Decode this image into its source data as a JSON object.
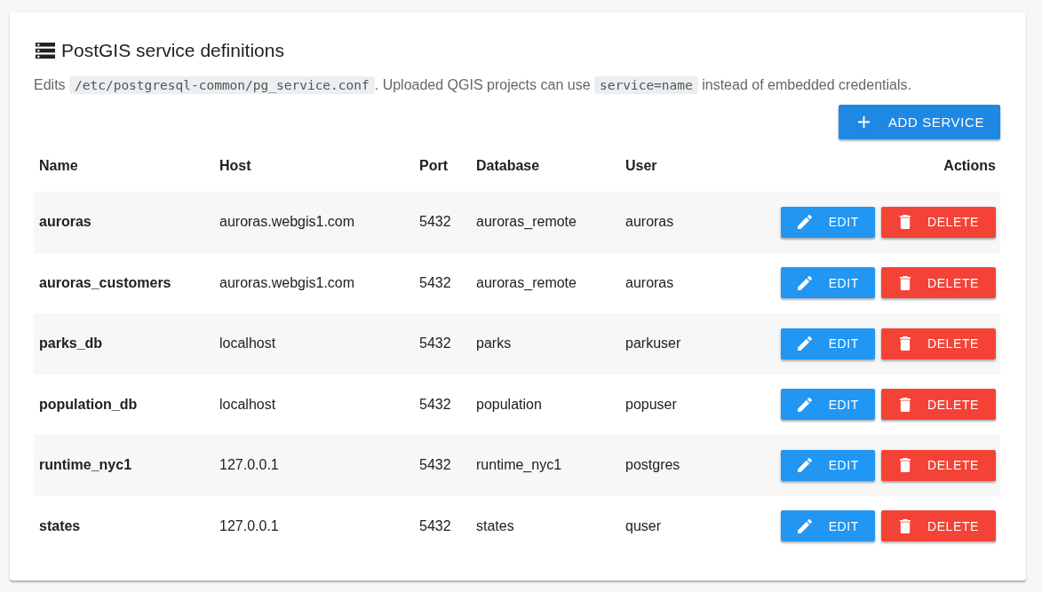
{
  "card": {
    "title": "PostGIS service definitions",
    "description": [
      {
        "kind": "text",
        "text": "Edits "
      },
      {
        "kind": "code",
        "text": "/etc/postgresql-common/pg_service.conf"
      },
      {
        "kind": "text",
        "text": ". Uploaded QGIS projects can use "
      },
      {
        "kind": "code",
        "text": "service=name"
      },
      {
        "kind": "text",
        "text": " instead of embedded credentials."
      }
    ],
    "add_button": {
      "label": "ADD SERVICE"
    }
  },
  "table": {
    "columns": [
      "Name",
      "Host",
      "Port",
      "Database",
      "User",
      "Actions"
    ],
    "rows": [
      {
        "name": "auroras",
        "host": "auroras.webgis1.com",
        "port": "5432",
        "database": "auroras_remote",
        "user": "auroras",
        "actions": [
          {
            "kind": "edit",
            "label": "EDIT"
          },
          {
            "kind": "delete",
            "label": "DELETE"
          }
        ]
      },
      {
        "name": "auroras_customers",
        "host": "auroras.webgis1.com",
        "port": "5432",
        "database": "auroras_remote",
        "user": "auroras",
        "actions": [
          {
            "kind": "edit",
            "label": "EDIT"
          },
          {
            "kind": "delete",
            "label": "DELETE"
          }
        ]
      },
      {
        "name": "parks_db",
        "host": "localhost",
        "port": "5432",
        "database": "parks",
        "user": "parkuser",
        "actions": [
          {
            "kind": "edit",
            "label": "EDIT"
          },
          {
            "kind": "delete",
            "label": "DELETE"
          }
        ]
      },
      {
        "name": "population_db",
        "host": "localhost",
        "port": "5432",
        "database": "population",
        "user": "popuser",
        "actions": [
          {
            "kind": "edit",
            "label": "EDIT"
          },
          {
            "kind": "delete",
            "label": "DELETE"
          }
        ]
      },
      {
        "name": "runtime_nyc1",
        "host": "127.0.0.1",
        "port": "5432",
        "database": "runtime_nyc1",
        "user": "postgres",
        "actions": [
          {
            "kind": "edit",
            "label": "EDIT"
          },
          {
            "kind": "delete",
            "label": "DELETE"
          }
        ]
      },
      {
        "name": "states",
        "host": "127.0.0.1",
        "port": "5432",
        "database": "states",
        "user": "quser",
        "actions": [
          {
            "kind": "edit",
            "label": "EDIT"
          },
          {
            "kind": "delete",
            "label": "DELETE"
          }
        ]
      }
    ]
  }
}
